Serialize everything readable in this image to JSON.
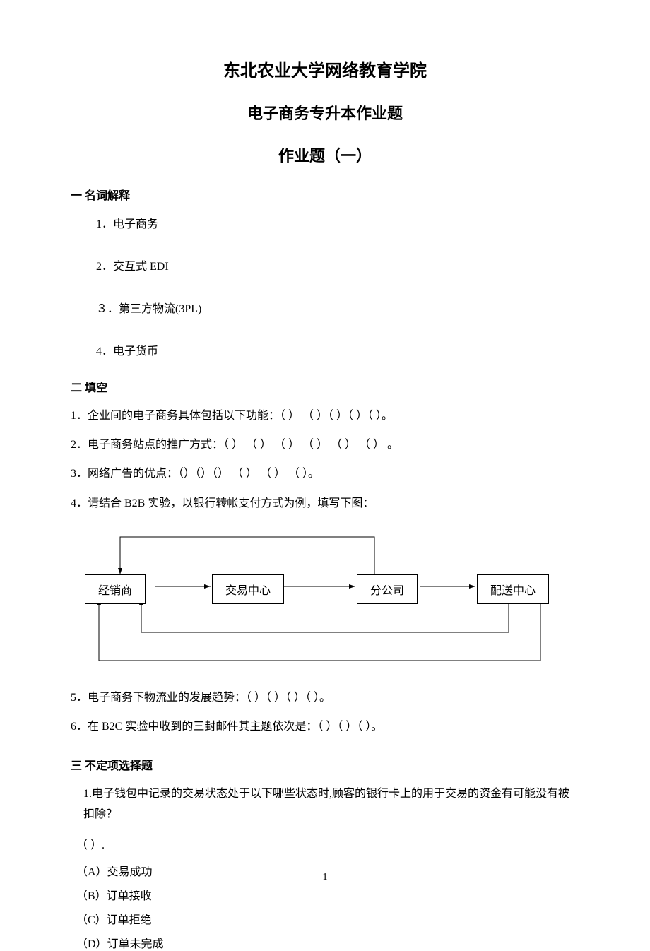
{
  "titles": {
    "line1": "东北农业大学网络教育学院",
    "line2": "电子商务专升本作业题",
    "line3": "作业题（一）"
  },
  "section1": {
    "head": "一 名词解释",
    "items": [
      "1．电子商务",
      "2．交互式 EDI",
      "３．第三方物流(3PL)",
      "4．电子货币"
    ]
  },
  "section2": {
    "head": "二 填空",
    "items": [
      "1．企业间的电子商务具体包括以下功能：（        ） （        ）（     ）（       ）（       ）。",
      "2．电子商务站点的推广方式：（  ） （  ） （  ） （  ） （  ） （  ） 。",
      "3．网络广告的优点：（）（）（） （ ）  （ ） （ ）。",
      "4．请结合 B2B 实验，以银行转帐支付方式为例，填写下图：",
      "5．电子商务下物流业的发展趋势：（  ）（  ）（  ）（  ）。",
      "6．在 B2C 实验中收到的三封邮件其主题依次是：（  ）（  ）（  ）。"
    ]
  },
  "diagram": {
    "boxes": [
      "经销商",
      "交易中心",
      "分公司",
      "配送中心"
    ]
  },
  "section3": {
    "head": "三 不定项选择题",
    "q1": "1.电子钱包中记录的交易状态处于以下哪些状态时,顾客的银行卡上的用于交易的资金有可能没有被扣除？",
    "blank": "（             ）.",
    "options": [
      "（A）交易成功",
      "（B）订单接收",
      "（C）订单拒绝",
      "（D）订单未完成"
    ]
  },
  "page_number": "1"
}
